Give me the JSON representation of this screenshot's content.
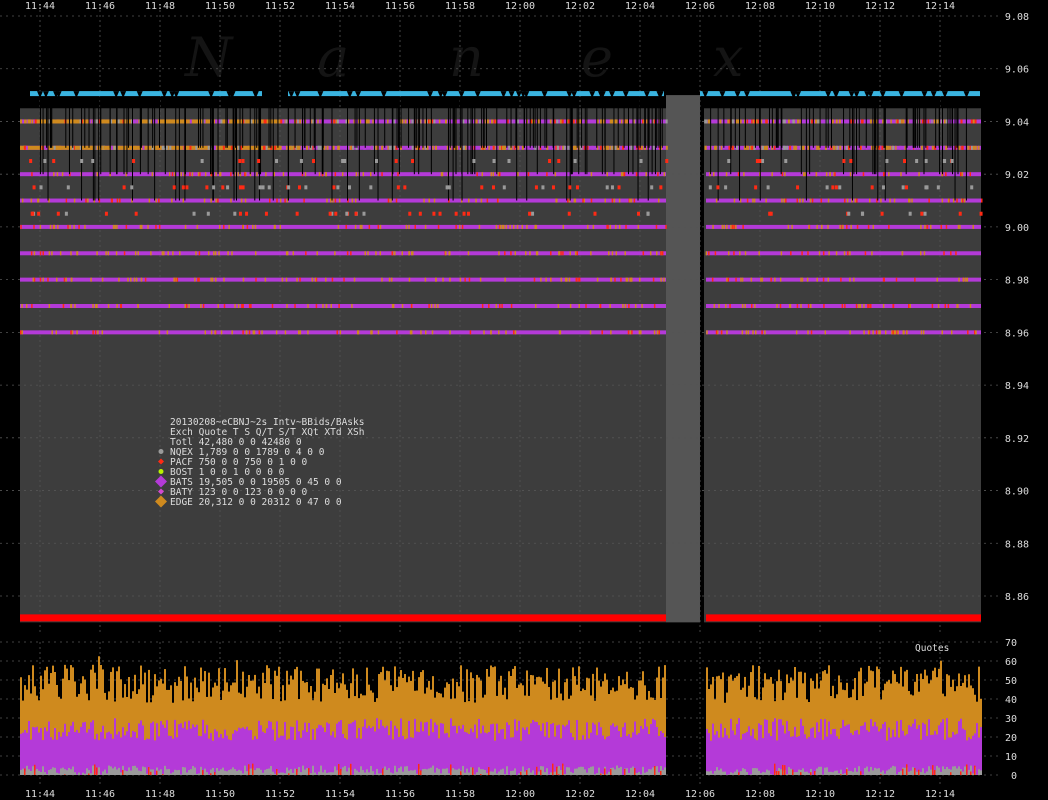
{
  "watermark": "N a n e x",
  "colors": {
    "background": "#000000",
    "plot_area": "#3d3d3d",
    "NQEX": "#9a9a9a",
    "PACF": "#ff2a14",
    "BOST": "#b8f200",
    "BATS": "#b43ad8",
    "BATY": "#d44ad0",
    "EDGE": "#cf8a1e",
    "ask_marker": "#3ab4e0",
    "bid_line": "#ff0000",
    "grid": "#555555",
    "text": "#dddddd"
  },
  "legend": {
    "title": "20130208~eCBNJ~2s Intv~BBids/BAsks",
    "header": "Exch  Quote T S  Q/T   S/T  XQt XTd XSh",
    "rows": [
      {
        "key": "total",
        "text": "Totl 42,480 0 0 42480     0",
        "marker": "",
        "color": "#dddddd"
      },
      {
        "key": "NQEX",
        "text": "NQEX  1,789 0 0  1789     0    4   0   0",
        "marker": "circle",
        "color": "#9a9a9a"
      },
      {
        "key": "PACF",
        "text": "PACF    750 0 0   750     0    1   0   0",
        "marker": "diamond",
        "color": "#ff2a14"
      },
      {
        "key": "BOST",
        "text": "BOST      1 0 0     1     0    0   0   0",
        "marker": "circle",
        "color": "#b8f200"
      },
      {
        "key": "BATS",
        "text": "BATS 19,505 0 0 19505     0   45   0   0",
        "marker": "diamond-large",
        "color": "#b43ad8"
      },
      {
        "key": "BATY",
        "text": "BATY    123 0 0   123     0    0   0   0",
        "marker": "diamond",
        "color": "#d44ad0"
      },
      {
        "key": "EDGE",
        "text": "EDGE 20,312 0 0 20312     0   47   0   0",
        "marker": "diamond-large",
        "color": "#cf8a1e"
      }
    ]
  },
  "chart_data": [
    {
      "type": "scatter",
      "x_ticks": [
        "11:44",
        "11:46",
        "11:48",
        "11:50",
        "11:52",
        "11:54",
        "11:56",
        "11:58",
        "12:00",
        "12:02",
        "12:04",
        "12:06",
        "12:08",
        "12:10",
        "12:12",
        "12:14"
      ],
      "ylim": [
        8.85,
        9.08
      ],
      "y_ticks": [
        "8.86",
        "8.88",
        "8.90",
        "8.92",
        "8.94",
        "8.96",
        "8.98",
        "9.00",
        "9.02",
        "9.04",
        "9.06",
        "9.08"
      ],
      "grid": true,
      "data_gap": {
        "start": "12:04:30",
        "end": "12:05:40"
      },
      "bid_level": 8.85,
      "best_ask_level": 9.05,
      "series": [
        {
          "name": "BATS",
          "levels": [
            8.96,
            8.97,
            8.98,
            8.99,
            9.0,
            9.01,
            9.02,
            9.03,
            9.04
          ]
        },
        {
          "name": "EDGE",
          "levels": [
            9.03,
            9.04
          ]
        },
        {
          "name": "PACF",
          "levels": [
            9.0,
            9.01,
            9.02
          ]
        },
        {
          "name": "NQEX",
          "levels": [
            9.02,
            9.03,
            9.04
          ]
        }
      ]
    },
    {
      "type": "area",
      "label": "Quotes",
      "x_ticks": [
        "11:44",
        "11:46",
        "11:48",
        "11:50",
        "11:52",
        "11:54",
        "11:56",
        "11:58",
        "12:00",
        "12:02",
        "12:04",
        "12:06",
        "12:08",
        "12:10",
        "12:12",
        "12:14"
      ],
      "ylim": [
        0,
        70
      ],
      "y_ticks": [
        "0",
        "10",
        "20",
        "30",
        "40",
        "50",
        "60",
        "70"
      ],
      "grid": true,
      "data_gap": {
        "start": "12:04:30",
        "end": "12:05:40"
      },
      "series": [
        {
          "name": "EDGE",
          "typical_range": [
            38,
            58
          ]
        },
        {
          "name": "BATS",
          "typical_range": [
            18,
            30
          ]
        },
        {
          "name": "PACF",
          "typical_range": [
            0,
            6
          ]
        },
        {
          "name": "NQEX",
          "typical_range": [
            0,
            5
          ]
        }
      ]
    }
  ]
}
